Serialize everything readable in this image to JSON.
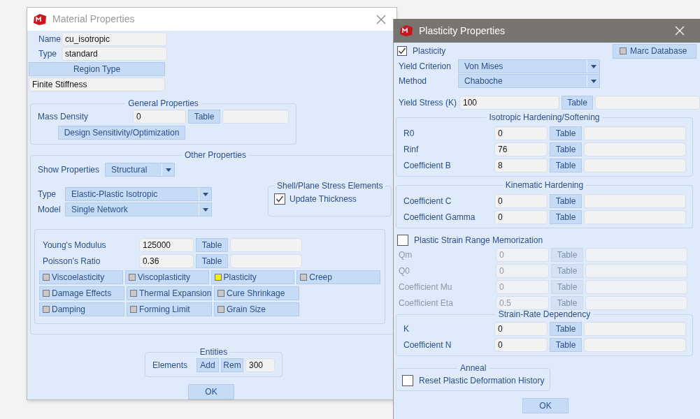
{
  "material_window": {
    "title": "Material Properties",
    "name": {
      "label": "Name",
      "value": "cu_isotropic"
    },
    "type": {
      "label": "Type",
      "value": "standard"
    },
    "region_type_button": "Region Type",
    "region_value": "Finite Stiffness",
    "general_properties": {
      "title": "General Properties",
      "mass_density": {
        "label": "Mass Density",
        "value": "0",
        "table_button": "Table"
      },
      "design_button": "Design Sensitivity/Optimization"
    },
    "other_properties": {
      "title": "Other Properties",
      "show_properties": {
        "label": "Show Properties",
        "value": "Structural"
      },
      "type": {
        "label": "Type",
        "value": "Elastic-Plastic Isotropic"
      },
      "model": {
        "label": "Model",
        "value": "Single Network"
      },
      "shell_group": {
        "title": "Shell/Plane Stress Elements",
        "update_thickness": {
          "label": "Update Thickness",
          "checked": true
        }
      },
      "rows": [
        {
          "label": "Young's Modulus",
          "value": "125000",
          "table_button": "Table"
        },
        {
          "label": "Poisson's Ratio",
          "value": "0.36",
          "table_button": "Table"
        }
      ],
      "toggles": [
        [
          {
            "label": "Viscoelasticity",
            "on": false
          },
          {
            "label": "Viscoplasticity",
            "on": false
          },
          {
            "label": "Plasticity",
            "on": true
          },
          {
            "label": "Creep",
            "on": false
          }
        ],
        [
          {
            "label": "Damage Effects",
            "on": false
          },
          {
            "label": "Thermal Expansion",
            "on": false
          },
          {
            "label": "Cure Shrinkage",
            "on": false
          }
        ],
        [
          {
            "label": "Damping",
            "on": false
          },
          {
            "label": "Forming Limit",
            "on": false
          },
          {
            "label": "Grain Size",
            "on": false
          }
        ]
      ]
    },
    "entities": {
      "title": "Entities",
      "label": "Elements",
      "add_button": "Add",
      "rem_button": "Rem",
      "value": "300"
    },
    "ok_button": "OK"
  },
  "plasticity_window": {
    "title": "Plasticity Properties",
    "plasticity": {
      "label": "Plasticity",
      "checked": true
    },
    "marc_database": {
      "label": "Marc Database",
      "on": false
    },
    "yield_criterion": {
      "label": "Yield Criterion",
      "value": "Von Mises"
    },
    "method": {
      "label": "Method",
      "value": "Chaboche"
    },
    "yield_stress": {
      "label": "Yield Stress (K)",
      "value": "100",
      "table_button": "Table"
    },
    "isotropic_hardening": {
      "title": "Isotropic Hardening/Softening",
      "rows": [
        {
          "label": "R0",
          "value": "0",
          "table_button": "Table"
        },
        {
          "label": "Rinf",
          "value": "76",
          "table_button": "Table"
        },
        {
          "label": "Coefficient B",
          "value": "8",
          "table_button": "Table"
        }
      ]
    },
    "kinematic_hardening": {
      "title": "Kinematic Hardening",
      "rows": [
        {
          "label": "Coefficient C",
          "value": "0",
          "table_button": "Table"
        },
        {
          "label": "Coefficient Gamma",
          "value": "0",
          "table_button": "Table"
        }
      ]
    },
    "memorization": {
      "label": "Plastic Strain Range Memorization",
      "checked": false,
      "rows": [
        {
          "label": "Qm",
          "value": "0",
          "table_button": "Table",
          "disabled": true
        },
        {
          "label": "Q0",
          "value": "0",
          "table_button": "Table",
          "disabled": true
        },
        {
          "label": "Coefficient Mu",
          "value": "0",
          "table_button": "Table",
          "disabled": true
        },
        {
          "label": "Coefficient Eta",
          "value": "0.5",
          "table_button": "Table",
          "disabled": true
        }
      ]
    },
    "strain_rate": {
      "title": "Strain-Rate Dependency",
      "rows": [
        {
          "label": "K",
          "value": "0",
          "table_button": "Table"
        },
        {
          "label": "Coefficient N",
          "value": "0",
          "table_button": "Table"
        }
      ]
    },
    "anneal": {
      "title": "Anneal",
      "reset": {
        "label": "Reset Plastic Deformation History",
        "checked": false
      }
    },
    "ok_button": "OK"
  }
}
